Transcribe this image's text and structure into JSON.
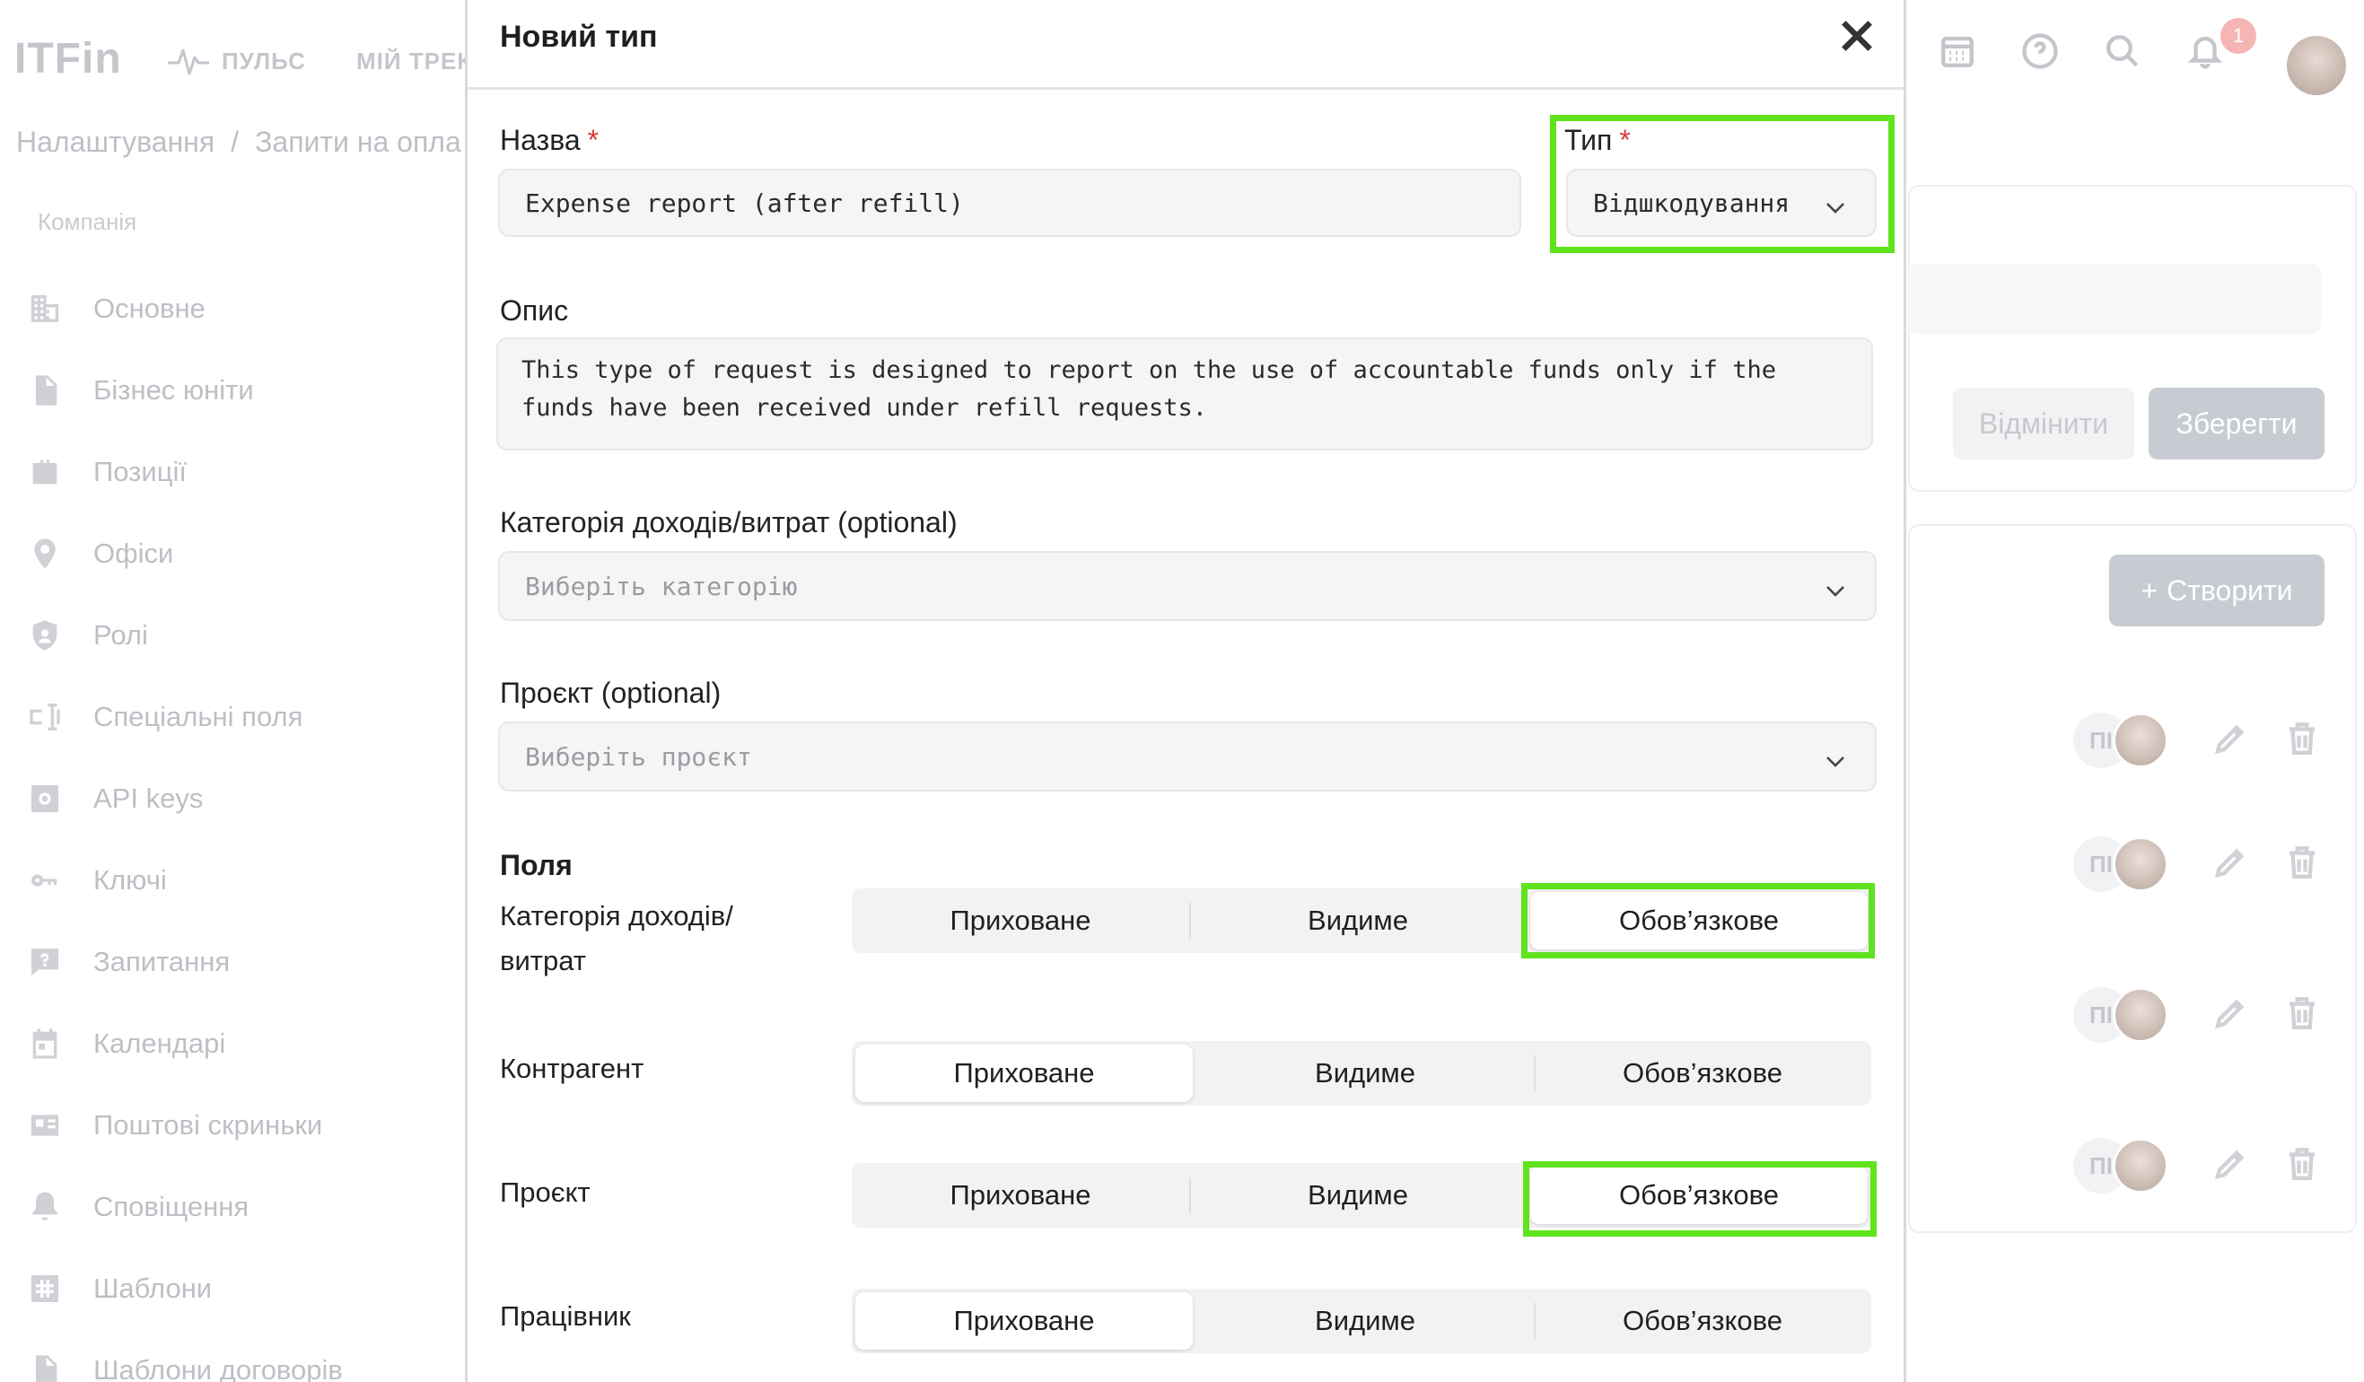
{
  "app": {
    "logo": "ITFin",
    "nav": [
      {
        "label": "ПУЛЬС",
        "icon": "pulse-icon"
      },
      {
        "label": "МІЙ ТРЕК",
        "icon": ""
      }
    ],
    "breadcrumb": {
      "first": "Налаштування",
      "sep": "/",
      "second": "Запити на опла"
    },
    "sidebar_caption": "Компанія",
    "sidebar": [
      {
        "label": "Основне",
        "icon": "building-icon"
      },
      {
        "label": "Бізнес юніти",
        "icon": "document-icon"
      },
      {
        "label": "Позиції",
        "icon": "briefcase-icon"
      },
      {
        "label": "Офіси",
        "icon": "location-pin-icon"
      },
      {
        "label": "Ролі",
        "icon": "shield-user-icon"
      },
      {
        "label": "Спеціальні поля",
        "icon": "custom-field-icon"
      },
      {
        "label": "API keys",
        "icon": "api-gear-icon"
      },
      {
        "label": "Ключі",
        "icon": "key-icon"
      },
      {
        "label": "Запитання",
        "icon": "question-chat-icon"
      },
      {
        "label": "Календарі",
        "icon": "calendar-icon"
      },
      {
        "label": "Поштові скриньки",
        "icon": "mailbox-icon"
      },
      {
        "label": "Сповіщення",
        "icon": "bell-icon"
      },
      {
        "label": "Шаблони",
        "icon": "hashtag-icon"
      },
      {
        "label": "Шаблони договорів",
        "icon": "file-icon"
      }
    ],
    "notification_count": "1",
    "buttons": {
      "cancel": "Відмінити",
      "save": "Зберегти",
      "create": "Створити",
      "create_plus": "+"
    },
    "row_initials": "ПІ"
  },
  "modal": {
    "title": "Новий тип",
    "name": {
      "label": "Назва",
      "required": "*",
      "value": "Expense report (after refill)"
    },
    "type": {
      "label": "Тип",
      "required": "*",
      "value": "Відшкодування"
    },
    "description": {
      "label": "Опис",
      "value": "This type of request is designed to report on the use of accountable funds only if the funds have been received under refill requests."
    },
    "category": {
      "label": "Категорія доходів/витрат (optional)",
      "placeholder": "Виберіть категорію"
    },
    "project": {
      "label": "Проєкт (optional)",
      "placeholder": "Виберіть проєкт"
    },
    "fields_title": "Поля",
    "options": [
      "Приховане",
      "Видиме",
      "Обов’язкове"
    ],
    "fields": [
      {
        "label": "Категорія доходів/ витрат",
        "selected": 2
      },
      {
        "label": "Контрагент",
        "selected": 0
      },
      {
        "label": "Проєкт",
        "selected": 2
      },
      {
        "label": "Працівник",
        "selected": 0
      }
    ]
  },
  "colors": {
    "highlight": "#5fe31c",
    "required": "#d93a3a"
  }
}
